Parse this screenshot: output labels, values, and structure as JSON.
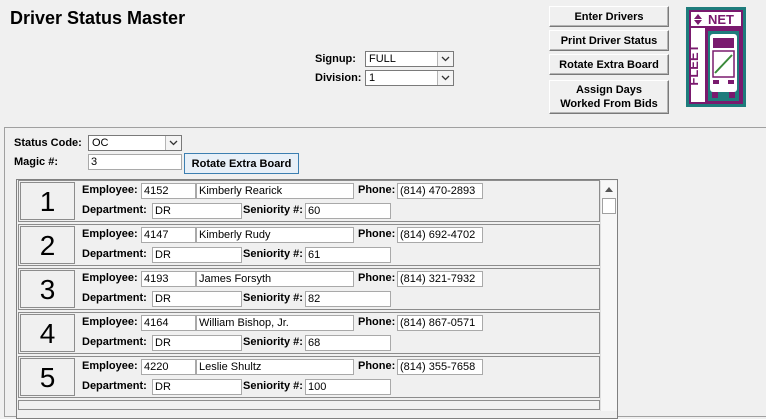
{
  "title": "Driver Status Master",
  "buttons": {
    "enter_drivers": "Enter Drivers",
    "print_driver_status": "Print Driver Status",
    "rotate_extra_board": "Rotate Extra Board",
    "assign_days_line1": "Assign Days",
    "assign_days_line2": "Worked From Bids"
  },
  "signup": {
    "label": "Signup:",
    "value": "FULL"
  },
  "division": {
    "label": "Division:",
    "value": "1"
  },
  "status_code": {
    "label": "Status Code:",
    "value": "OC"
  },
  "magic": {
    "label": "Magic #:",
    "value": "3"
  },
  "panel_rotate_button": "Rotate Extra Board",
  "logo": {
    "top_text": "NET",
    "side_text": "FLEET",
    "colors": {
      "purple": "#7a1a6e",
      "teal": "#1e7c7c",
      "green": "#3a8a3a"
    }
  },
  "labels": {
    "employee": "Employee:",
    "phone": "Phone:",
    "department": "Department:",
    "seniority": "Seniority #:"
  },
  "records": [
    {
      "num": "1",
      "emp_id": "4152",
      "name": "Kimberly Rearick",
      "phone": "(814) 470-2893",
      "dept": "DR",
      "seniority": "60"
    },
    {
      "num": "2",
      "emp_id": "4147",
      "name": "Kimberly Rudy",
      "phone": "(814) 692-4702",
      "dept": "DR",
      "seniority": "61"
    },
    {
      "num": "3",
      "emp_id": "4193",
      "name": "James Forsyth",
      "phone": "(814) 321-7932",
      "dept": "DR",
      "seniority": "82"
    },
    {
      "num": "4",
      "emp_id": "4164",
      "name": "William Bishop, Jr.",
      "phone": "(814) 867-0571",
      "dept": "DR",
      "seniority": "68"
    },
    {
      "num": "5",
      "emp_id": "4220",
      "name": "Leslie Shultz",
      "phone": "(814) 355-7658",
      "dept": "DR",
      "seniority": "100"
    }
  ]
}
